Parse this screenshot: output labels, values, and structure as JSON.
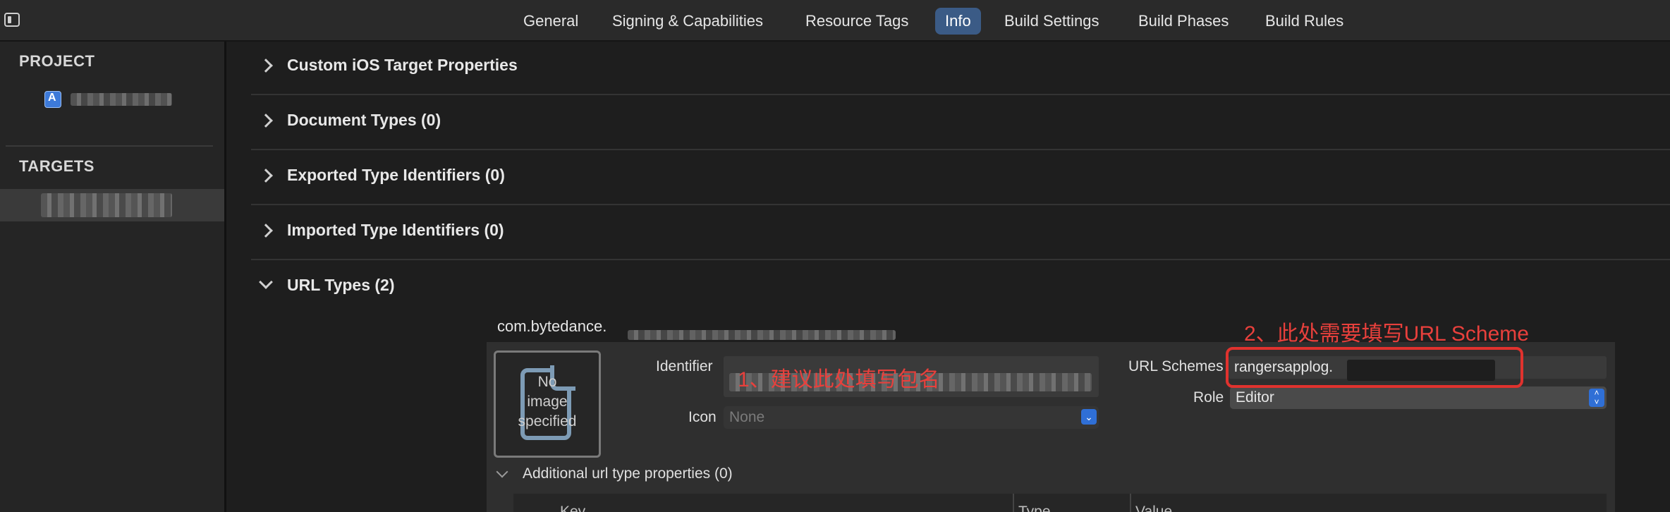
{
  "toolbar": {
    "tabs": [
      {
        "label": "General",
        "active": false
      },
      {
        "label": "Signing & Capabilities",
        "active": false
      },
      {
        "label": "Resource Tags",
        "active": false
      },
      {
        "label": "Info",
        "active": true
      },
      {
        "label": "Build Settings",
        "active": false
      },
      {
        "label": "Build Phases",
        "active": false
      },
      {
        "label": "Build Rules",
        "active": false
      }
    ]
  },
  "navigator": {
    "project_header": "PROJECT",
    "targets_header": "TARGETS"
  },
  "sections": [
    {
      "title": "Custom iOS Target Properties",
      "expanded": false
    },
    {
      "title": "Document Types (0)",
      "expanded": false
    },
    {
      "title": "Exported Type Identifiers (0)",
      "expanded": false
    },
    {
      "title": "Imported Type Identifiers (0)",
      "expanded": false
    },
    {
      "title": "URL Types (2)",
      "expanded": true
    }
  ],
  "url_type": {
    "name": "com.bytedance.",
    "image_well_text": [
      "No",
      "image",
      "specified"
    ],
    "identifier_label": "Identifier",
    "icon_label": "Icon",
    "icon_value": "None",
    "url_schemes_label": "URL Schemes",
    "url_schemes_value": "rangersapplog.",
    "role_label": "Role",
    "role_value": "Editor",
    "additional_properties": "Additional url type properties (0)"
  },
  "table": {
    "columns": [
      "Key",
      "Type",
      "Value"
    ]
  },
  "annotations": {
    "identifier_note": "1、建议此处填写包名",
    "scheme_note": "2、此处需要填写URL Scheme"
  },
  "colors": {
    "accent": "#3b5b86",
    "annotation_red": "#e8403c",
    "background": "#1e1e1e"
  }
}
